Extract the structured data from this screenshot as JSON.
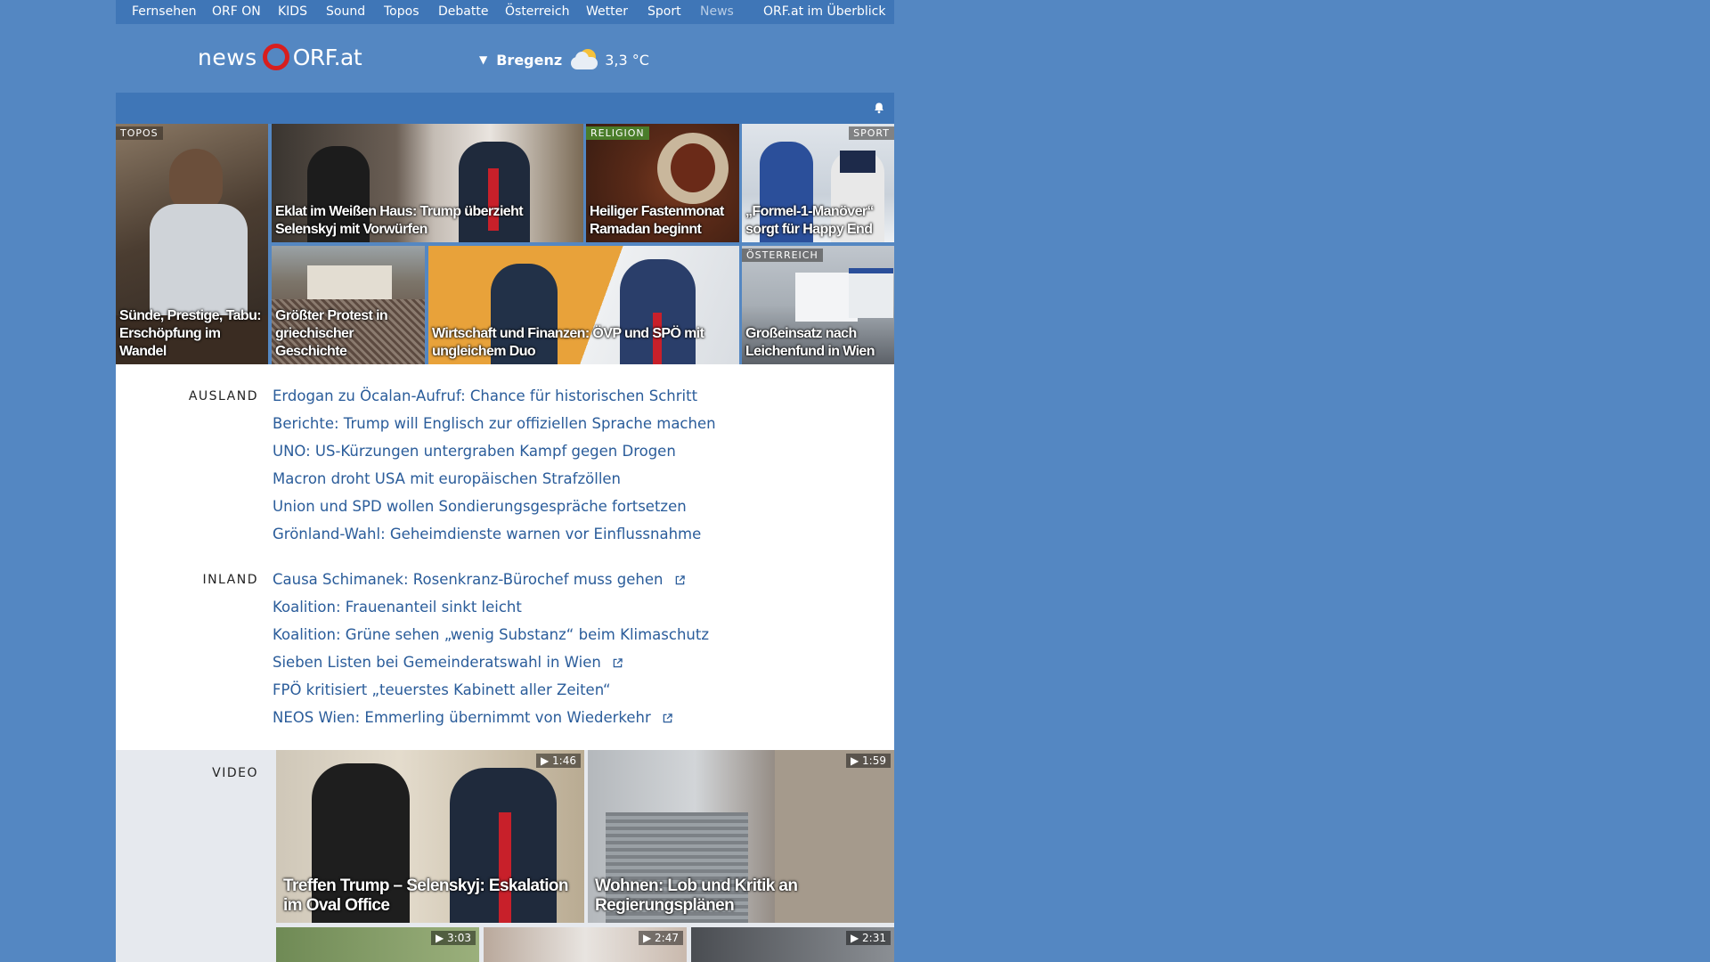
{
  "topnav": {
    "items": [
      "Fernsehen",
      "ORF ON",
      "KIDS",
      "Sound",
      "Topos",
      "Debatte",
      "Österreich",
      "Wetter",
      "Sport",
      "News"
    ],
    "overview": "ORF.at im Überblick"
  },
  "header": {
    "logo_news": "news",
    "logo_orf": "ORF.at",
    "weather_city": "Bregenz",
    "weather_icon": "partly-cloudy-icon",
    "weather_temp": "3,3 °C"
  },
  "teasers": {
    "t1": {
      "tag": "TOPOS",
      "title": "Sünde, Prestige, Tabu: Erschöpfung im Wandel"
    },
    "t2": {
      "title": "Eklat im Weißen Haus: Trump überzieht Selenskyj mit Vorwürfen"
    },
    "t3": {
      "tag": "RELIGION",
      "title": "Heiliger Fastenmonat Ramadan beginnt"
    },
    "t4": {
      "tag": "SPORT",
      "title": "„Formel-1-Manöver“ sorgt für Happy End"
    },
    "t5": {
      "title": "Größter Protest in griechischer Geschichte"
    },
    "t6": {
      "title": "Wirtschaft und Finanzen: ÖVP und SPÖ mit ungleichem Duo"
    },
    "t7": {
      "tag": "ÖSTERREICH",
      "title": "Großeinsatz nach Leichenfund in Wien"
    }
  },
  "ausland": {
    "label": "AUSLAND",
    "links": [
      "Erdogan zu Öcalan-Aufruf: Chance für historischen Schritt",
      "Berichte: Trump will Englisch zur offiziellen Sprache machen",
      "UNO: US-Kürzungen untergraben Kampf gegen Drogen",
      "Macron droht USA mit europäischen Strafzöllen",
      "Union und SPD wollen Sondierungsgespräche fortsetzen",
      "Grönland-Wahl: Geheimdienste warnen vor Einflussnahme"
    ]
  },
  "inland": {
    "label": "INLAND",
    "links": [
      "Causa Schimanek: Rosenkranz-Bürochef muss gehen",
      "Koalition: Frauenanteil sinkt leicht",
      "Koalition: Grüne sehen „wenig Substanz“ beim Klimaschutz",
      "Sieben Listen bei Gemeinderatswahl in Wien",
      "FPÖ kritisiert „teuerstes Kabinett aller Zeiten“",
      "NEOS Wien: Emmerling übernimmt von Wiederkehr"
    ]
  },
  "video": {
    "label": "VIDEO",
    "items": [
      {
        "duration": "1:46",
        "title": "Treffen Trump – Selenskyj: Eskalation im Oval Office"
      },
      {
        "duration": "1:59",
        "title": "Wohnen: Lob und Kritik an Regierungsplänen"
      },
      {
        "duration": "3:03"
      },
      {
        "duration": "2:47"
      },
      {
        "duration": "2:31"
      }
    ]
  }
}
